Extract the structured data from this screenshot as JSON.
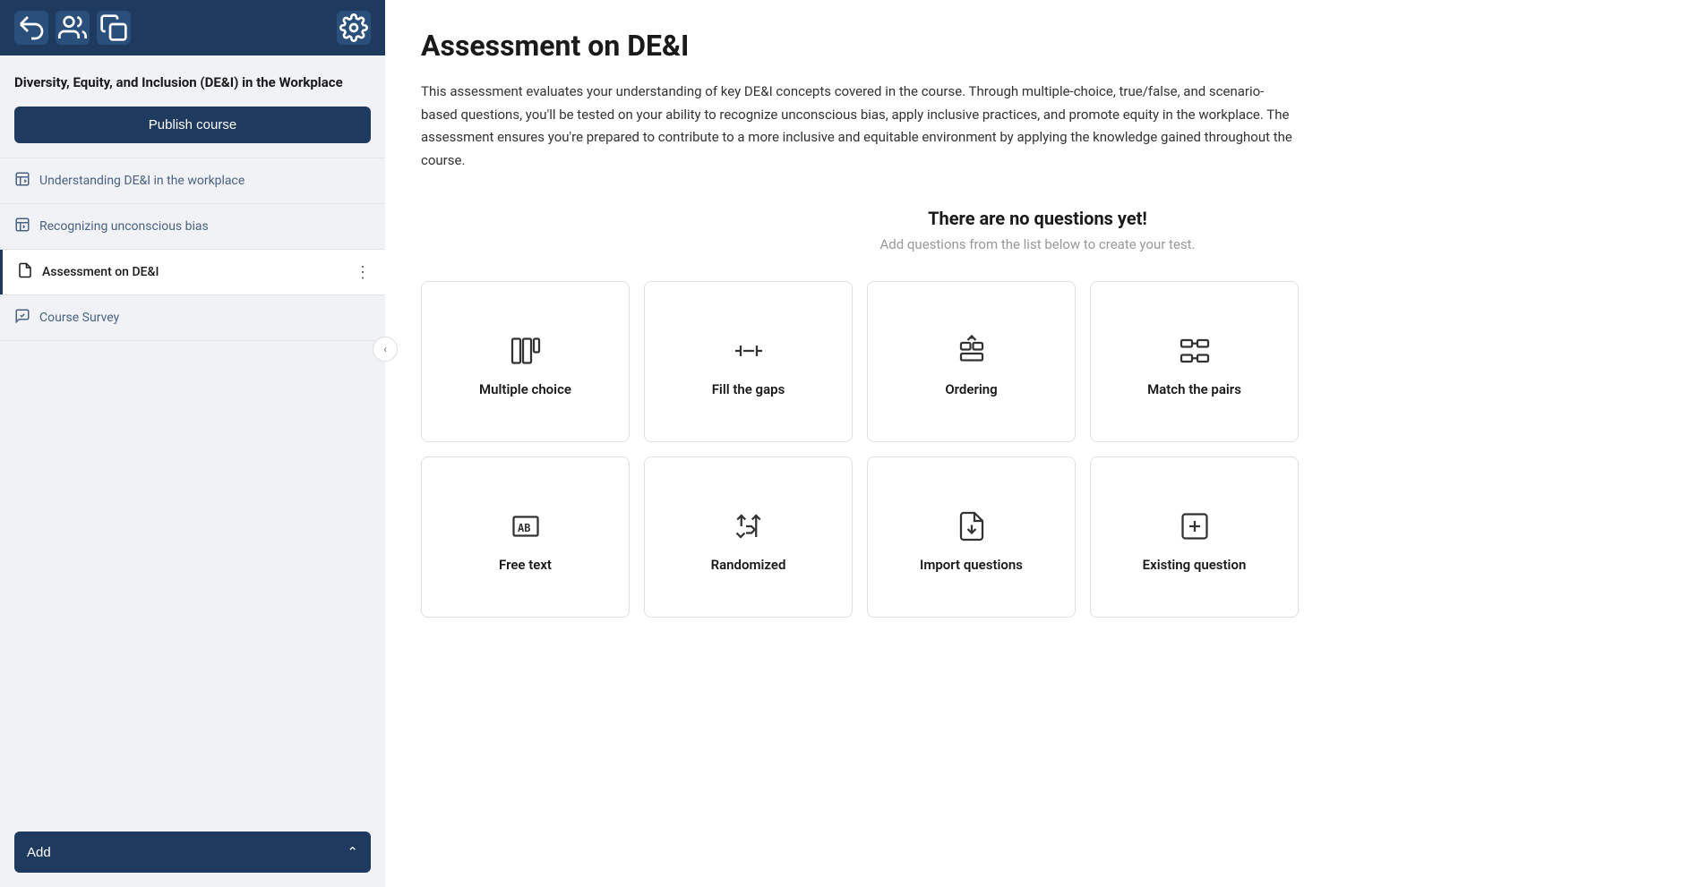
{
  "sidebar": {
    "courseTitle": "Diversity, Equity, and Inclusion (DE&I) in the Workplace",
    "publishButton": "Publish course",
    "addButton": "Add",
    "navItems": [
      {
        "id": "understanding",
        "label": "Understanding DE&I in the workplace",
        "icon": "chart-edit",
        "active": false
      },
      {
        "id": "recognizing",
        "label": "Recognizing unconscious bias",
        "icon": "chart-edit",
        "active": false
      },
      {
        "id": "assessment",
        "label": "Assessment on DE&I",
        "icon": "document",
        "active": true,
        "showMore": true
      },
      {
        "id": "survey",
        "label": "Course Survey",
        "icon": "chat-check",
        "active": false
      }
    ]
  },
  "header": {
    "icons": [
      "share-icon",
      "users-icon",
      "copy-icon",
      "gear-icon"
    ]
  },
  "main": {
    "title": "Assessment on DE&I",
    "description": "This assessment evaluates your understanding of key DE&I concepts covered in the course. Through multiple-choice, true/false, and scenario-based questions, you'll be tested on your ability to recognize unconscious bias, apply inclusive practices, and promote equity in the workplace. The assessment ensures you're prepared to contribute to a more inclusive and equitable environment by applying the knowledge gained throughout the course.",
    "noQuestionsTitle": "There are no questions yet!",
    "noQuestionsSubtitle": "Add questions from the list below to create your test.",
    "questionTypes": [
      {
        "id": "multiple-choice",
        "label": "Multiple choice",
        "iconType": "multiple-choice"
      },
      {
        "id": "fill-the-gaps",
        "label": "Fill the gaps",
        "iconType": "fill-the-gaps"
      },
      {
        "id": "ordering",
        "label": "Ordering",
        "iconType": "ordering"
      },
      {
        "id": "match-the-pairs",
        "label": "Match the pairs",
        "iconType": "match-the-pairs"
      },
      {
        "id": "free-text",
        "label": "Free text",
        "iconType": "free-text"
      },
      {
        "id": "randomized",
        "label": "Randomized",
        "iconType": "randomized"
      },
      {
        "id": "import-questions",
        "label": "Import questions",
        "iconType": "import-questions"
      },
      {
        "id": "existing-question",
        "label": "Existing question",
        "iconType": "existing-question"
      }
    ]
  },
  "colors": {
    "sidebarBg": "#1e3a5f",
    "contentBg": "#f0f2f5",
    "accent": "#1e3a5f",
    "activeNavBorder": "#1e3a5f"
  }
}
